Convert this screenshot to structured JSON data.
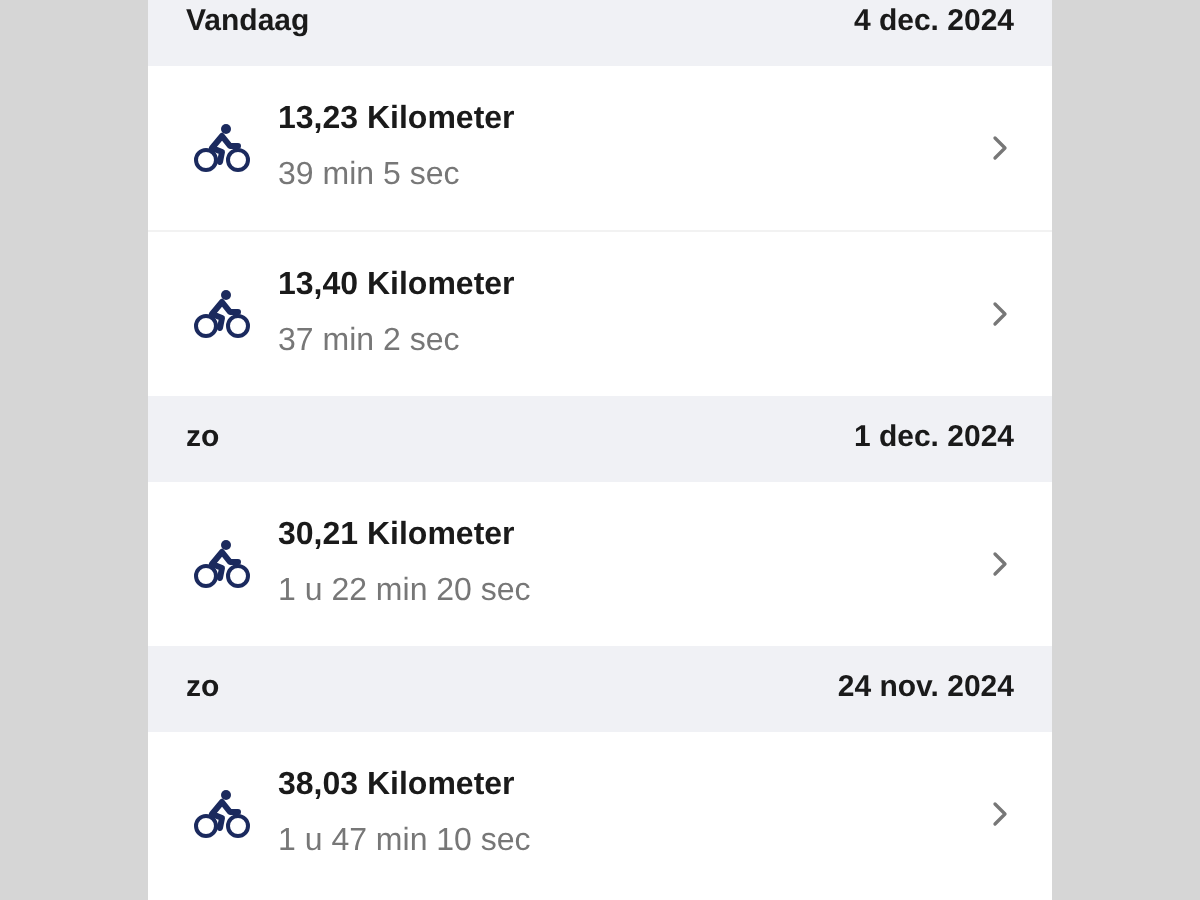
{
  "sections": [
    {
      "day": "Vandaag",
      "date": "4 dec. 2024",
      "rides": [
        {
          "distance": "13,23 Kilometer",
          "duration": "39 min 5 sec"
        },
        {
          "distance": "13,40 Kilometer",
          "duration": "37 min 2 sec"
        }
      ]
    },
    {
      "day": "zo",
      "date": "1 dec. 2024",
      "rides": [
        {
          "distance": "30,21 Kilometer",
          "duration": "1 u 22 min 20 sec"
        }
      ]
    },
    {
      "day": "zo",
      "date": "24 nov. 2024",
      "rides": [
        {
          "distance": "38,03 Kilometer",
          "duration": "1 u 47 min 10 sec"
        }
      ]
    }
  ]
}
